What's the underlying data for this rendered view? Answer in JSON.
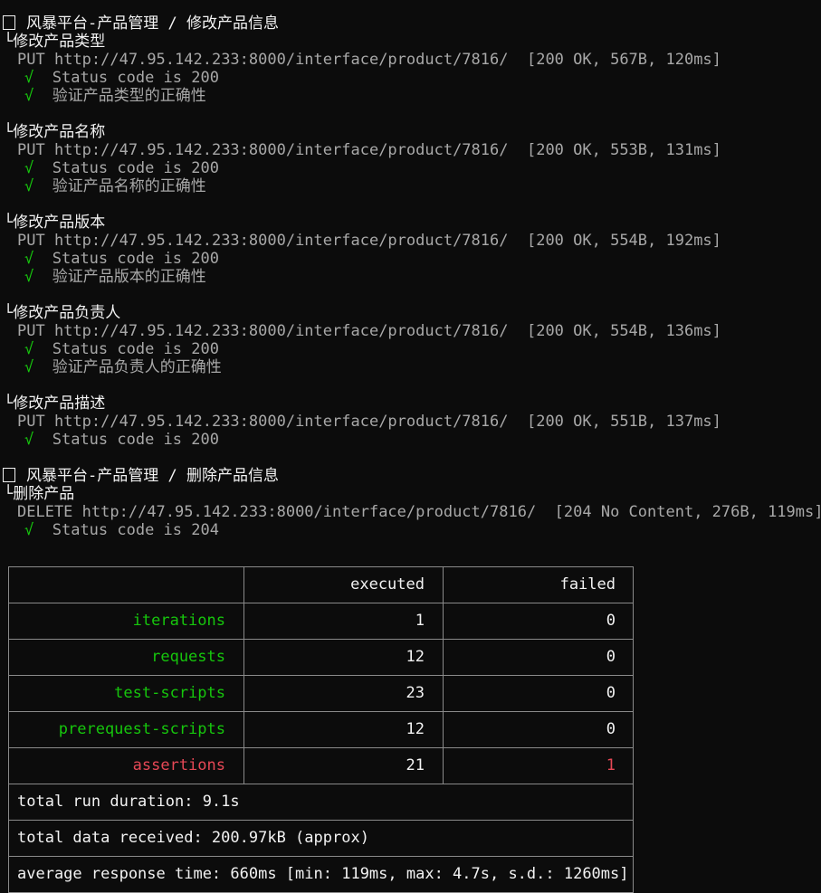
{
  "collections": [
    {
      "title": "风暴平台-产品管理 / 修改产品信息",
      "requests": [
        {
          "name": "修改产品类型",
          "method": "PUT",
          "url": "http://47.95.142.233:8000/interface/product/7816/",
          "result": "[200 OK, 567B, 120ms]",
          "tests": [
            "Status code is 200",
            "验证产品类型的正确性"
          ]
        },
        {
          "name": "修改产品名称",
          "method": "PUT",
          "url": "http://47.95.142.233:8000/interface/product/7816/",
          "result": "[200 OK, 553B, 131ms]",
          "tests": [
            "Status code is 200",
            "验证产品名称的正确性"
          ]
        },
        {
          "name": "修改产品版本",
          "method": "PUT",
          "url": "http://47.95.142.233:8000/interface/product/7816/",
          "result": "[200 OK, 554B, 192ms]",
          "tests": [
            "Status code is 200",
            "验证产品版本的正确性"
          ]
        },
        {
          "name": "修改产品负责人",
          "method": "PUT",
          "url": "http://47.95.142.233:8000/interface/product/7816/",
          "result": "[200 OK, 554B, 136ms]",
          "tests": [
            "Status code is 200",
            "验证产品负责人的正确性"
          ]
        },
        {
          "name": "修改产品描述",
          "method": "PUT",
          "url": "http://47.95.142.233:8000/interface/product/7816/",
          "result": "[200 OK, 551B, 137ms]",
          "tests": [
            "Status code is 200"
          ]
        }
      ]
    },
    {
      "title": "风暴平台-产品管理 / 删除产品信息",
      "requests": [
        {
          "name": "删除产品",
          "method": "DELETE",
          "url": "http://47.95.142.233:8000/interface/product/7816/",
          "result": "[204 No Content, 276B, 119ms]",
          "tests": [
            "Status code is 204"
          ]
        }
      ]
    }
  ],
  "tree_branch": "└",
  "check_mark": "√",
  "summary": {
    "headers": {
      "executed": "executed",
      "failed": "failed"
    },
    "rows": [
      {
        "label": "iterations",
        "executed": "1",
        "failed": "0",
        "color": "green"
      },
      {
        "label": "requests",
        "executed": "12",
        "failed": "0",
        "color": "green"
      },
      {
        "label": "test-scripts",
        "executed": "23",
        "failed": "0",
        "color": "green"
      },
      {
        "label": "prerequest-scripts",
        "executed": "12",
        "failed": "0",
        "color": "green"
      },
      {
        "label": "assertions",
        "executed": "21",
        "failed": "1",
        "color": "red"
      }
    ],
    "total_run_duration": "total run duration: 9.1s",
    "total_data_received": "total data received: 200.97kB (approx)",
    "average_response_time": "average response time: 660ms [min: 119ms, max: 4.7s, s.d.: 1260ms]"
  },
  "colors": {
    "background": "#0c0c0c",
    "text": "#cccccc",
    "bright_text": "#f2f2f2",
    "success": "#16c60c",
    "error": "#e74856",
    "border": "#8a8a8a"
  }
}
